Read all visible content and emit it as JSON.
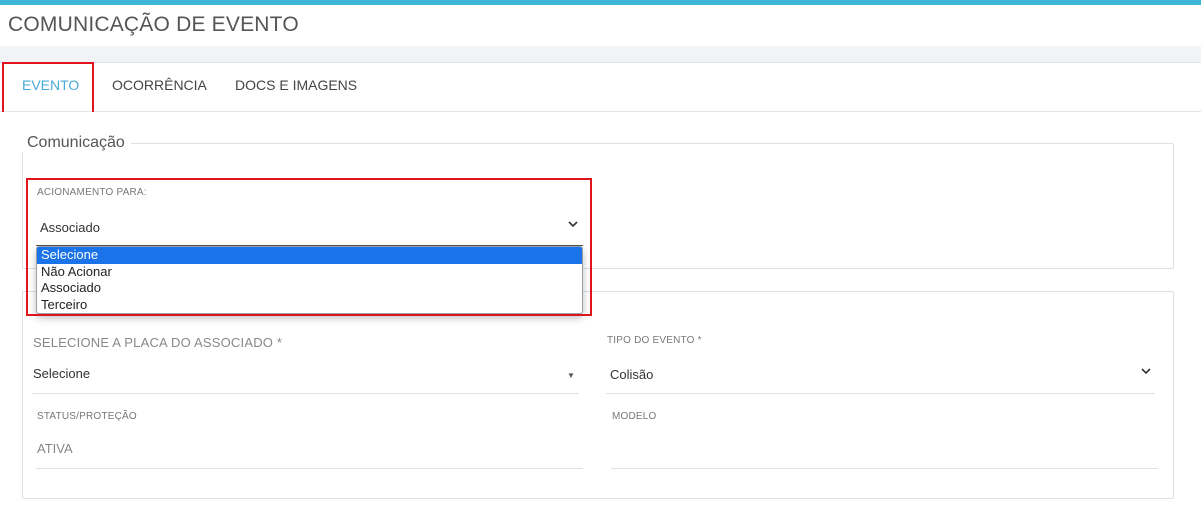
{
  "header": {
    "title": "COMUNICAÇÃO DE EVENTO"
  },
  "tabs": [
    {
      "label": "EVENTO",
      "active": true
    },
    {
      "label": "OCORRÊNCIA",
      "active": false
    },
    {
      "label": "DOCS E IMAGENS",
      "active": false
    }
  ],
  "comunicacao": {
    "legend": "Comunicação",
    "acionamento": {
      "label": "ACIONAMENTO PARA:",
      "value": "Associado",
      "options": [
        "Selecione",
        "Não Acionar",
        "Associado",
        "Terceiro"
      ],
      "highlighted_option": "Selecione"
    }
  },
  "evento": {
    "placa": {
      "label": "SELECIONE A PLACA DO ASSOCIADO *",
      "value": "Selecione"
    },
    "tipo": {
      "label": "TIPO DO EVENTO *",
      "value": "Colisão"
    },
    "status": {
      "label": "STATUS/PROTEÇÃO",
      "value": "ATIVA"
    },
    "modelo": {
      "label": "MODELO",
      "value": ""
    }
  },
  "colors": {
    "accent": "#3fb7d6",
    "active_tab": "#49a9d6",
    "highlight_border": "#e0141c",
    "option_selected": "#1a73e8"
  },
  "icons": {
    "select_chevron": "chevron-down-icon",
    "select_caret": "caret-down-icon"
  }
}
